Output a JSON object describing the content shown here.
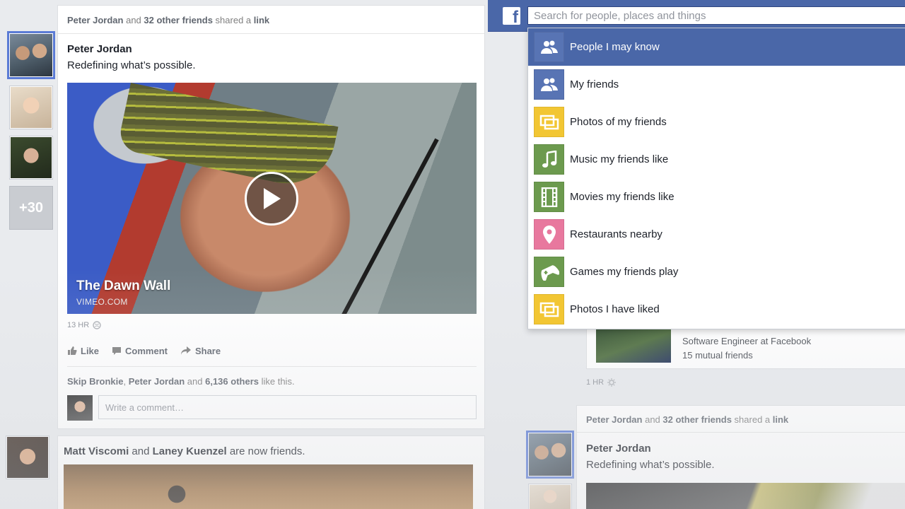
{
  "main_post": {
    "share_header": {
      "actor": "Peter Jordan",
      "connector": " and ",
      "others": "32 other friends",
      "verb": " shared a ",
      "object": "link"
    },
    "author": "Peter Jordan",
    "text": "Redefining what’s possible.",
    "video": {
      "title": "The Dawn Wall",
      "source": "VIMEO.COM"
    },
    "time": "13 HR",
    "actions": {
      "like": "Like",
      "comment": "Comment",
      "share": "Share"
    },
    "likes": {
      "a": "Skip Bronkie",
      "sep": ", ",
      "b": "Peter Jordan",
      "and": " and ",
      "count": "6,136 others",
      "suffix": " like this."
    },
    "comment_placeholder": "Write a comment…"
  },
  "friend_avatars": {
    "more_count": "+30"
  },
  "second_post": {
    "a": "Matt Viscomi",
    "and": " and ",
    "b": "Laney Kuenzel",
    "suffix": " are now friends."
  },
  "search": {
    "placeholder": "Search for people, places and things",
    "suggestions": [
      {
        "label": "People I may know",
        "icon": "people-icon",
        "color": "#5874b4",
        "active": true
      },
      {
        "label": "My friends",
        "icon": "people-icon",
        "color": "#5874b4",
        "active": false
      },
      {
        "label": "Photos of my friends",
        "icon": "photos-icon",
        "color": "#f2c633",
        "active": false
      },
      {
        "label": "Music my friends like",
        "icon": "music-icon",
        "color": "#6c9a4e",
        "active": false
      },
      {
        "label": "Movies my friends like",
        "icon": "film-icon",
        "color": "#6c9a4e",
        "active": false
      },
      {
        "label": "Restaurants nearby",
        "icon": "map-pin-icon",
        "color": "#e8789e",
        "active": false
      },
      {
        "label": "Games my friends play",
        "icon": "gamepad-icon",
        "color": "#6c9a4e",
        "active": false
      },
      {
        "label": "Photos I have liked",
        "icon": "photos-icon",
        "color": "#f2c633",
        "active": false
      }
    ]
  },
  "bg_card_a": {
    "line1": "Software Engineer at Facebook",
    "line2": "15 mutual friends",
    "time": "1 HR"
  },
  "bg_card_b": {
    "share_header": {
      "actor": "Peter Jordan",
      "connector": " and ",
      "others": "32 other friends",
      "verb": " shared a ",
      "object": "link"
    },
    "author": "Peter Jordan",
    "text": "Redefining what’s possible."
  },
  "colors": {
    "brand": "#4a67a8",
    "selection": "#5b7bd5"
  }
}
